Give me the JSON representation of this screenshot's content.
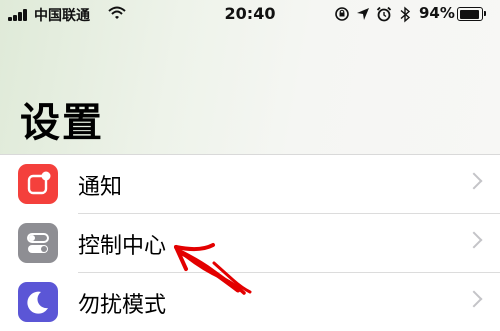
{
  "status_bar": {
    "carrier": "中国联通",
    "time": "20:40",
    "battery_percent": "94%",
    "battery_level": 0.94,
    "icons": [
      "signal-icon",
      "wifi-icon",
      "orientation-lock-icon",
      "location-icon",
      "alarm-icon",
      "bluetooth-icon",
      "battery-icon"
    ]
  },
  "page": {
    "title": "设置"
  },
  "settings": {
    "items": [
      {
        "label": "通知",
        "icon": "notifications-icon",
        "color": "#f4403c"
      },
      {
        "label": "控制中心",
        "icon": "control-center-icon",
        "color": "#8e8e93"
      },
      {
        "label": "勿扰模式",
        "icon": "do-not-disturb-icon",
        "color": "#5b56d6"
      }
    ]
  },
  "annotation": {
    "color": "#e30000",
    "icon": "hand-drawn-arrow-icon"
  }
}
